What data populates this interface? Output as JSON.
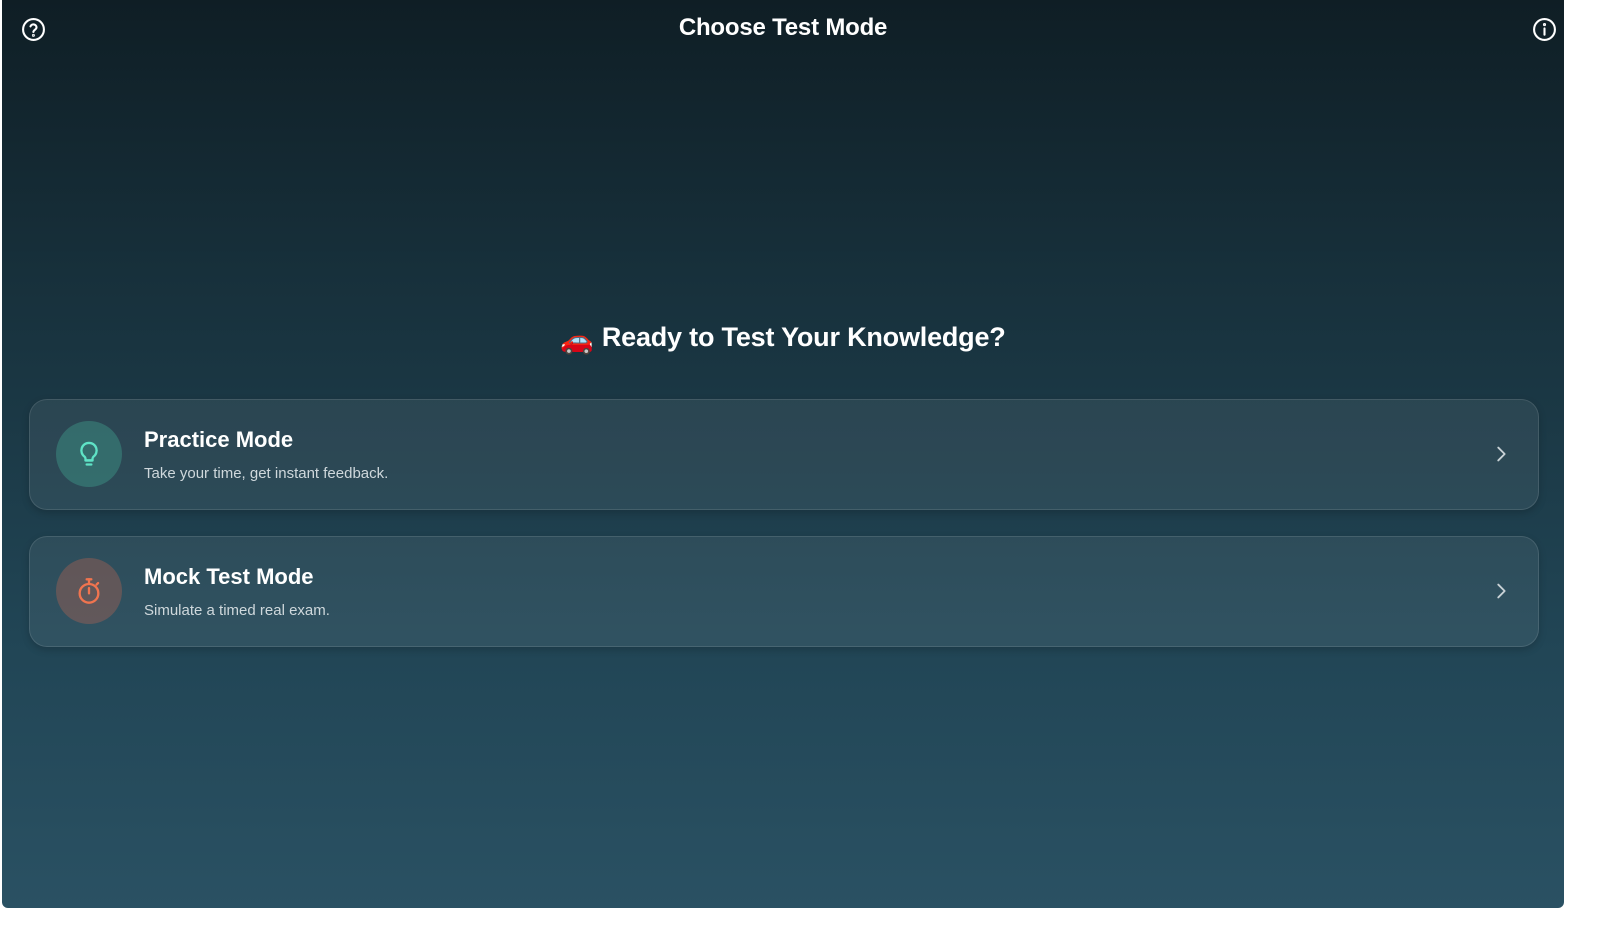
{
  "appbar": {
    "title": "Choose Test Mode",
    "help_icon": "help-circle-icon",
    "info_icon": "info-circle-icon"
  },
  "heading": {
    "emoji": "🚗",
    "text": "Ready to Test Your Knowledge?"
  },
  "modes": [
    {
      "title": "Practice Mode",
      "description": "Take your time, get instant feedback.",
      "icon": "lightbulb-icon",
      "accent": "#5fe3c6"
    },
    {
      "title": "Mock Test Mode",
      "description": "Simulate a timed real exam.",
      "icon": "stopwatch-icon",
      "accent": "#f0744f"
    }
  ],
  "colors": {
    "background_top": "#0f1e25",
    "background_bottom": "#2a5163"
  }
}
